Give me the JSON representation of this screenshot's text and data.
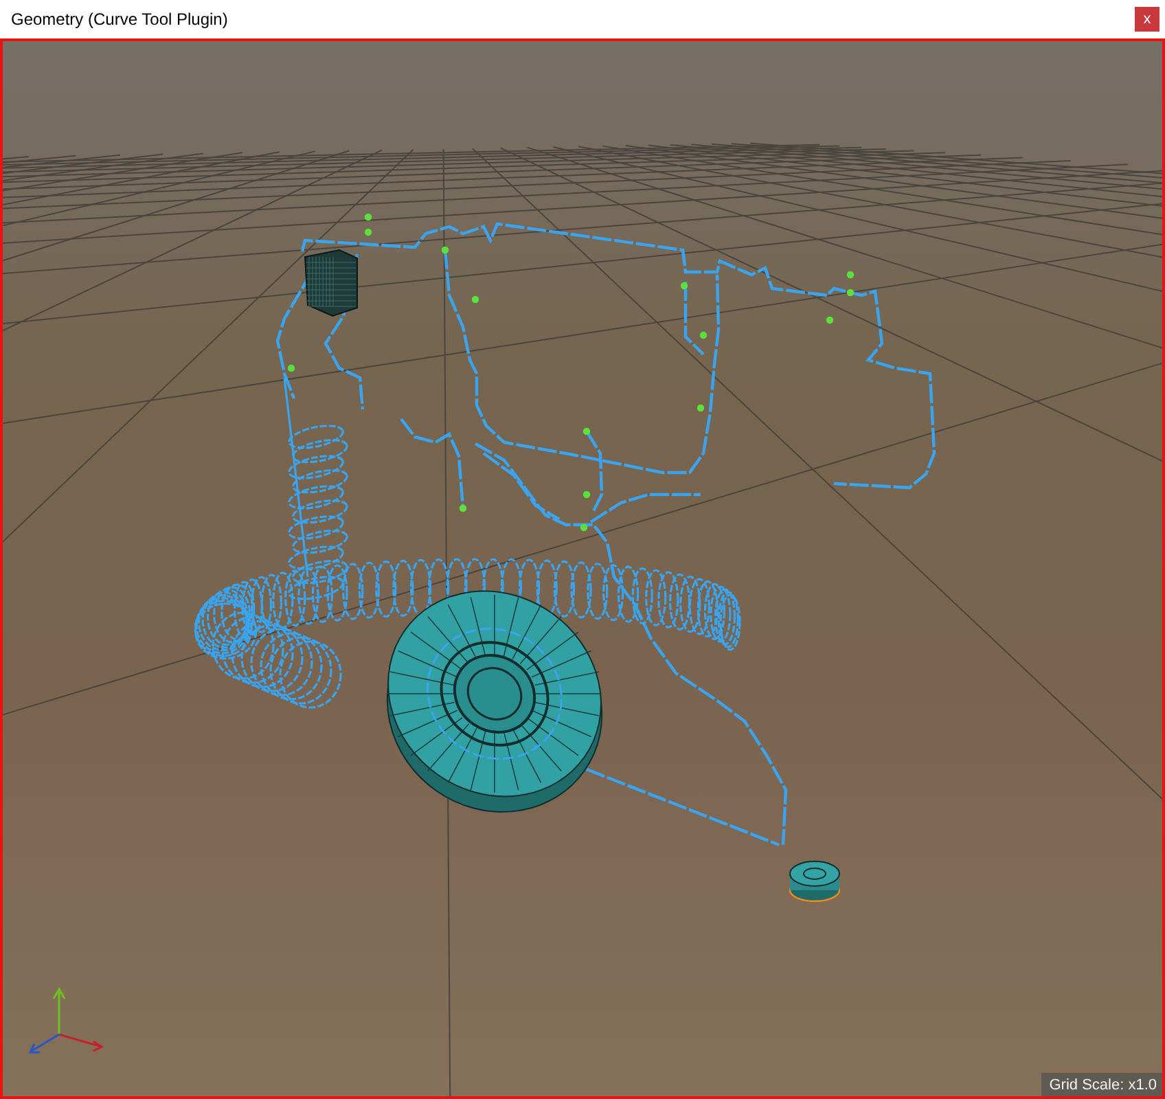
{
  "window": {
    "title": "Geometry (Curve Tool Plugin)",
    "close_label": "x"
  },
  "viewport": {
    "grid_scale": "Grid Scale: x1.0"
  }
}
